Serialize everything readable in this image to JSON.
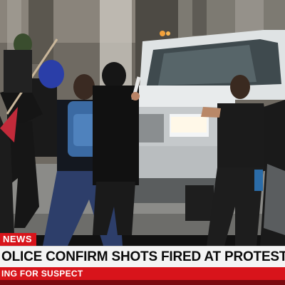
{
  "lower_third": {
    "tag": "NEWS",
    "headline": "OLICE CONFIRM SHOTS FIRED AT PROTEST, DR",
    "subhead": "ING FOR SUSPECT"
  },
  "colors": {
    "brand_red": "#d8141b",
    "headline_bg": "#f4f4f4",
    "truck_white": "#e6e9ea"
  },
  "scene": {
    "description_icons": [
      "white-pickup-truck",
      "protester-blue-beanie",
      "protester-blue-backpack",
      "protester-black-shirt",
      "raised-arm-hitting-truck"
    ]
  }
}
